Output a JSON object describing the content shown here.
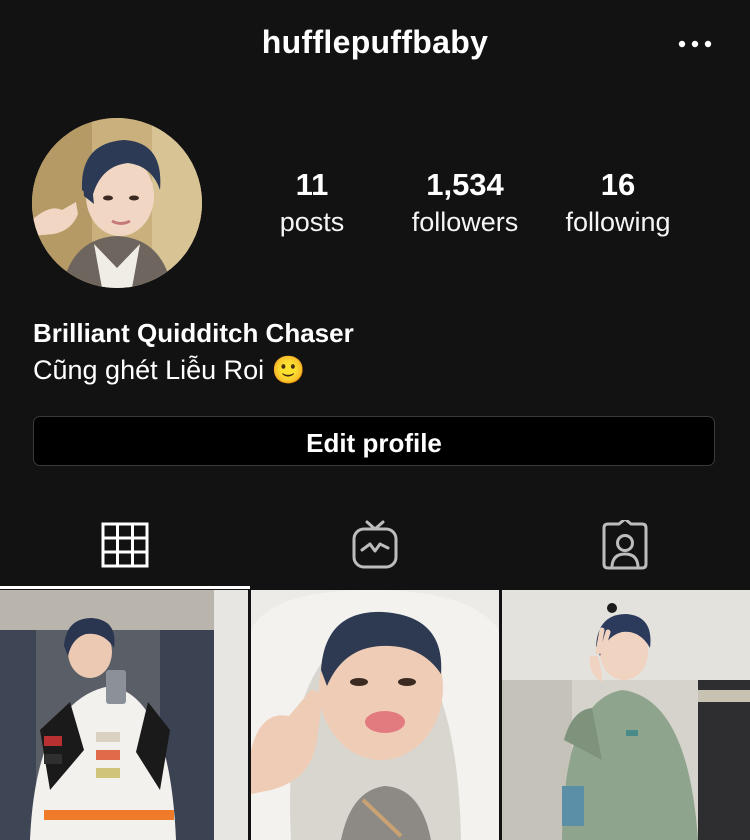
{
  "header": {
    "username": "hufflepuffbaby",
    "more_icon": "more-horizontal-icon"
  },
  "profile": {
    "avatar": "profile-photo",
    "stats": [
      {
        "value": "11",
        "label": "posts"
      },
      {
        "value": "1,534",
        "label": "followers"
      },
      {
        "value": "16",
        "label": "following"
      }
    ],
    "bio_name": "Brilliant Quidditch Chaser",
    "bio_text": "Cũng ghét Liễu Roi 🙂",
    "edit_button_label": "Edit profile"
  },
  "tabs": [
    {
      "icon": "grid-icon",
      "active": true
    },
    {
      "icon": "igtv-icon",
      "active": false
    },
    {
      "icon": "tagged-icon",
      "active": false
    }
  ],
  "posts": [
    {
      "icon": "photo-thumbnail"
    },
    {
      "icon": "photo-thumbnail"
    },
    {
      "icon": "photo-thumbnail"
    }
  ]
}
